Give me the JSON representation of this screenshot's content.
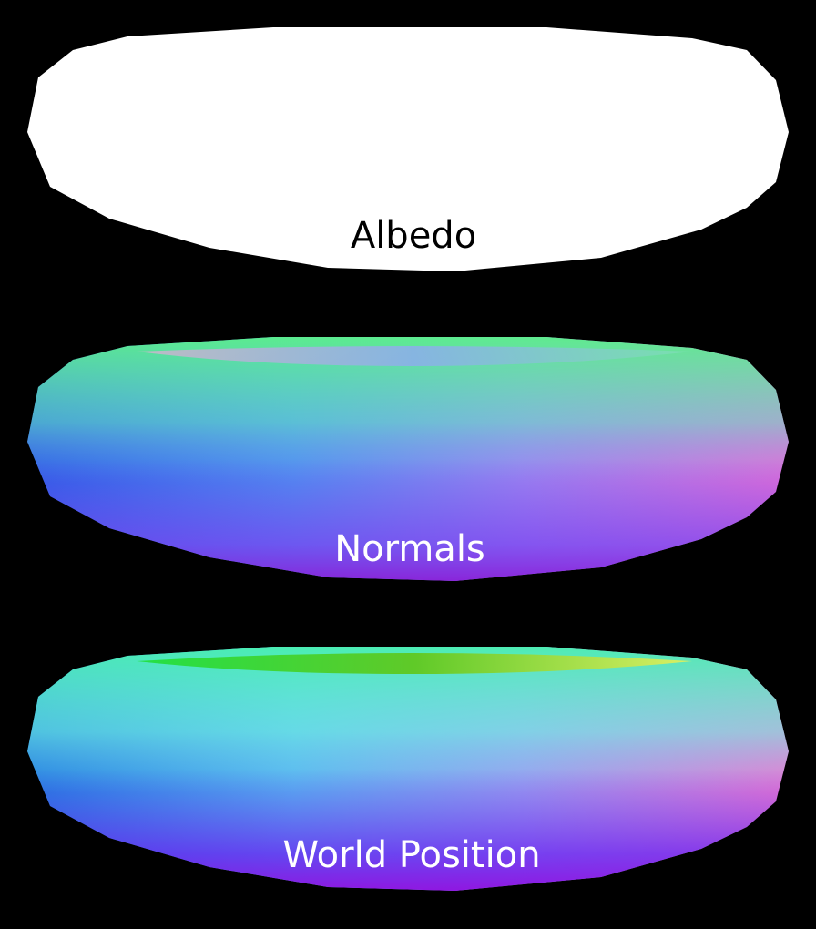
{
  "panels": [
    {
      "label": "Albedo",
      "label_color": "#000000"
    },
    {
      "label": "Normals",
      "label_color": "#ffffff"
    },
    {
      "label": "World Position",
      "label_color": "#ffffff"
    }
  ],
  "colors": {
    "background": "#000000",
    "albedo_fill": "#ffffff"
  }
}
